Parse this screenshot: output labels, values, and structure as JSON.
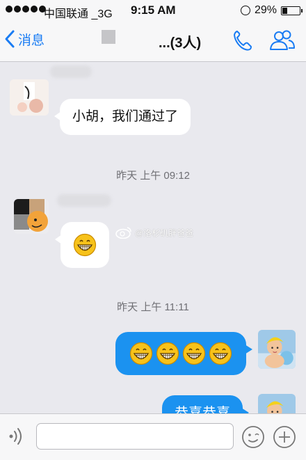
{
  "status_bar": {
    "carrier": "中国联通",
    "network": "3G",
    "time": "9:15 AM",
    "battery": "29%",
    "battery_level": 0.29
  },
  "nav": {
    "back_label": "消息",
    "title": "...(3人)"
  },
  "messages": [
    {
      "direction": "in",
      "text": "小胡，我们通过了"
    },
    {
      "type": "timestamp",
      "text": "昨天 上午 09:12"
    },
    {
      "direction": "in",
      "content": "grin-emoji",
      "count": 1
    },
    {
      "type": "timestamp",
      "text": "昨天 上午 11:11"
    },
    {
      "direction": "out",
      "content": "grin-emoji",
      "count": 4
    },
    {
      "direction": "out",
      "text": "恭喜恭喜"
    }
  ],
  "watermark": "@洛杉矶胖爸爸",
  "input_bar": {
    "placeholder": ""
  },
  "colors": {
    "accent": "#1a7cf3",
    "outgoing_bubble": "#1b92f0",
    "background": "#e9e9ee"
  },
  "icons": [
    "back-chevron-icon",
    "phone-icon",
    "group-icon",
    "voice-icon",
    "emoji-icon",
    "plus-icon",
    "grin-emoji-icon"
  ]
}
